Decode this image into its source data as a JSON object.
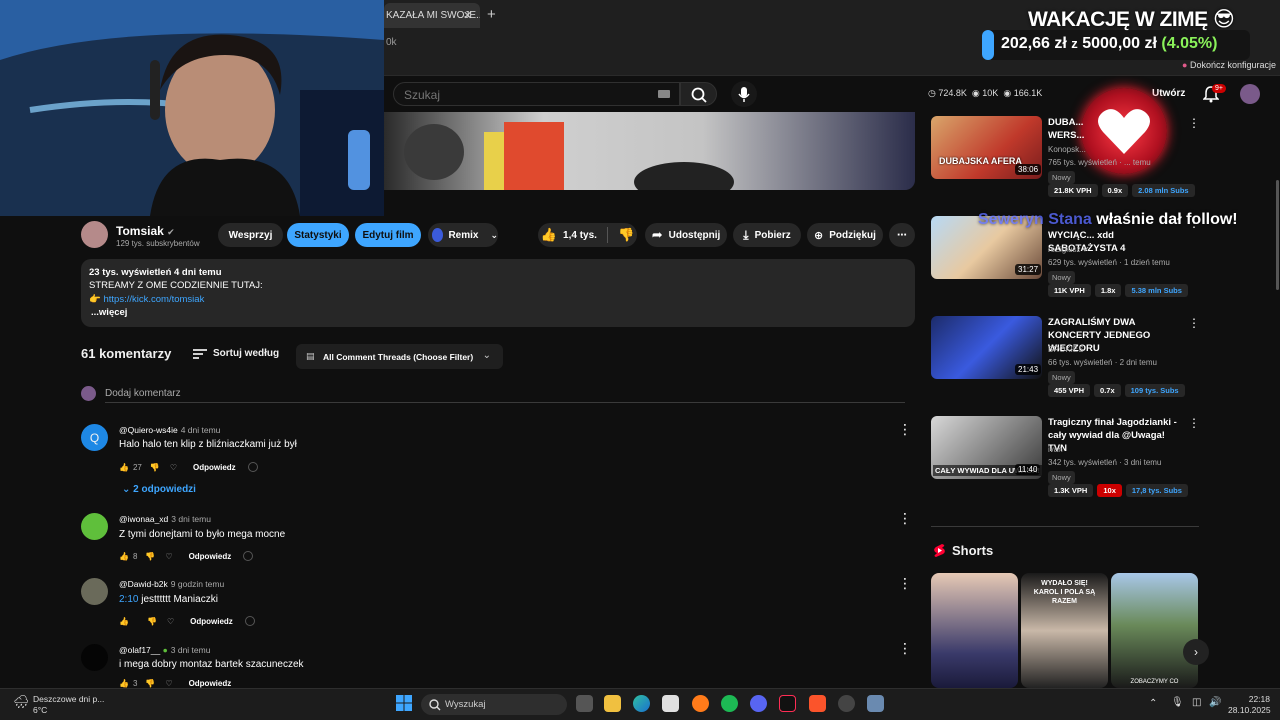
{
  "browser": {
    "tab_title": "KAZAŁA MI SWOJE...(s",
    "address_fragment": "0k"
  },
  "goal_overlay": {
    "title": "WAKACJĘ W ZIMĘ",
    "current": "202,66 zł",
    "separator": "z",
    "target": "5000,00 zł",
    "percent": "(4.05%)",
    "progress_fraction": 0.0405,
    "config_link": "Dokończ konfiguracje"
  },
  "header": {
    "search_placeholder": "Szukaj",
    "stat1": "724.8K",
    "stat2": "10K",
    "stat3": "166.1K",
    "create_label": "Utwórz",
    "notification_badge": "9+"
  },
  "follow_overlay": {
    "nick": "Seweryn Stana",
    "message": "właśnie dał follow!"
  },
  "channel": {
    "name": "Tomsiak",
    "subscribers": "129 tys. subskrybentów",
    "support_label": "Wesprzyj",
    "stats_label": "Statystyki",
    "edit_label": "Edytuj film",
    "remix_label": "Remix",
    "like_count": "1,4 tys.",
    "share_label": "Udostępnij",
    "download_label": "Pobierz",
    "thanks_label": "Podziękuj"
  },
  "description": {
    "meta": "23 tys. wyświetleń  4 dni temu",
    "line1": "STREAMY Z OME CODZIENNIE TUTAJ:",
    "link": "https://kick.com/tomsiak",
    "more": "...więcej"
  },
  "comments_header": {
    "count": "61 komentarzy",
    "sort_label": "Sortuj według",
    "filter_label": "All Comment Threads (Choose Filter)",
    "add_placeholder": "Dodaj komentarz"
  },
  "comments": [
    {
      "author": "@Quiero-ws4ie",
      "time": "4 dni temu",
      "text": "Halo halo ten klip z bliźniaczkami już był",
      "likes": "27",
      "reply": "Odpowiedz",
      "avatar_letter": "Q"
    },
    {
      "author": "@iwonaa_xd",
      "time": "3 dni temu",
      "text": "Z tymi donejtami to było mega mocne",
      "likes": "8",
      "reply": "Odpowiedz"
    },
    {
      "author": "@Dawid-b2k",
      "time": "9 godzin temu",
      "timestamp": "2:10",
      "text": " jestttttt Maniaczki",
      "likes": "",
      "reply": "Odpowiedz"
    },
    {
      "author": "@olaf17__",
      "time": "3 dni temu",
      "text": "i mega dobry montaz bartek szacuneczek",
      "likes": "3",
      "reply": "Odpowiedz"
    }
  ],
  "replies_toggle": "2 odpowiedzi",
  "sidebar": {
    "videos": [
      {
        "title": "DUBA... WERS...",
        "thumb_text": "DUBAJSKA AFERA",
        "channel": "Konopsk...",
        "meta": "765 tys. wyświetleń · ... temu",
        "badge": "Nowy",
        "duration": "38:06",
        "vph": "21.8K VPH",
        "ratio": "0.9x",
        "subs": "2.08 mln Subs"
      },
      {
        "title": "WYCIĄC... xdd SABOTAŻYSTA 4",
        "thumb_text": "",
        "channel": "reZigiusz",
        "meta": "629 tys. wyświetleń · 1 dzień temu",
        "badge": "Nowy",
        "duration": "31:27",
        "vph": "11K VPH",
        "ratio": "1.8x",
        "subs": "5.38 mln Subs"
      },
      {
        "title": "ZAGRALIŚMY DWA KONCERTY JEDNEGO WIECZORU",
        "thumb_text": "",
        "channel": "BROKIES",
        "meta": "66 tys. wyświetleń · 2 dni temu",
        "badge": "Nowy",
        "duration": "21:43",
        "vph": "455 VPH",
        "ratio": "0.7x",
        "subs": "109 tys. Subs"
      },
      {
        "title": "Tragiczny finał Jagodzianki - cały wywiad dla @Uwaga! TVN",
        "thumb_text": "CAŁY WYWIAD DLA UWAGA!",
        "channel": "ivan",
        "meta": "342 tys. wyświetleń · 3 dni temu",
        "badge": "Nowy",
        "duration": "11:40",
        "vph": "1.3K VPH",
        "ratio": "10x",
        "subs": "17,8 tys. Subs"
      }
    ],
    "shorts_title": "Shorts",
    "shorts": [
      {
        "caption": ""
      },
      {
        "caption": "WYDAŁO SIĘ! KAROL I POLA SĄ RAZEM"
      },
      {
        "caption": "ZOBACZYMY CO"
      }
    ]
  },
  "taskbar": {
    "weather_line1": "Deszczowe dni p...",
    "weather_line2": "6°C",
    "search_label": "Wyszukaj",
    "time": "22:18",
    "date": "28.10.2025"
  }
}
